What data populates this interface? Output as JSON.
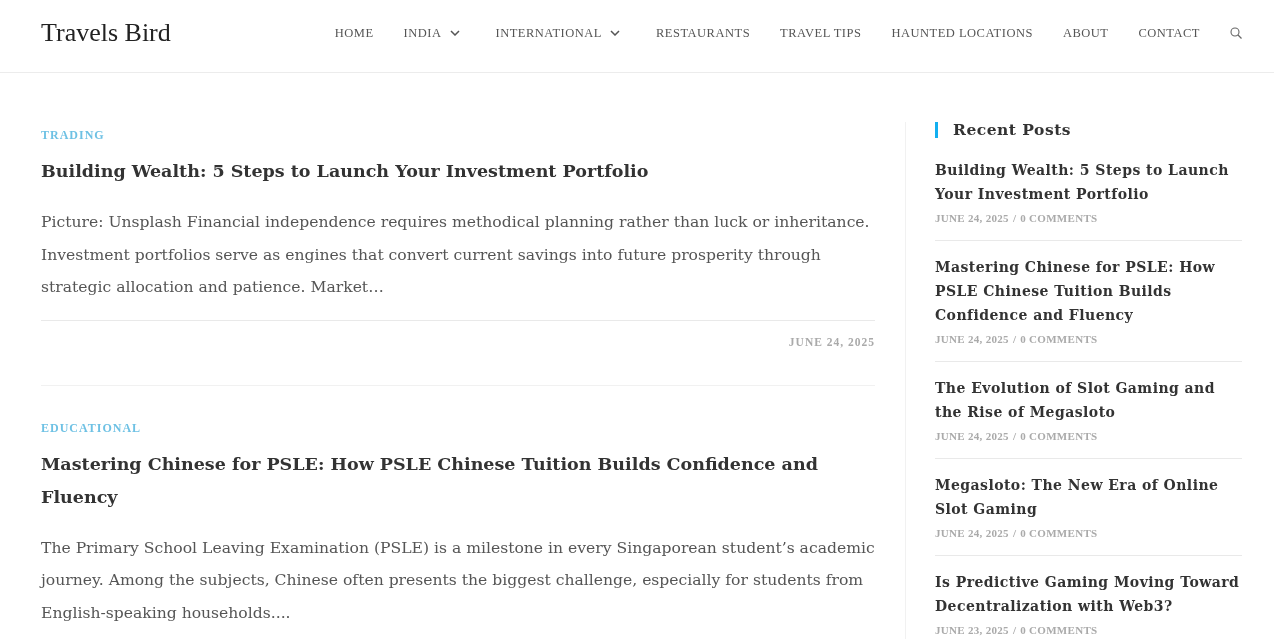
{
  "header": {
    "logo": "Travels Bird",
    "nav": [
      {
        "label": "HOME",
        "has_dropdown": false
      },
      {
        "label": "INDIA",
        "has_dropdown": true
      },
      {
        "label": "INTERNATIONAL",
        "has_dropdown": true
      },
      {
        "label": "RESTAURANTS",
        "has_dropdown": false
      },
      {
        "label": "TRAVEL TIPS",
        "has_dropdown": false
      },
      {
        "label": "HAUNTED LOCATIONS",
        "has_dropdown": false
      },
      {
        "label": "ABOUT",
        "has_dropdown": false
      },
      {
        "label": "CONTACT",
        "has_dropdown": false
      }
    ]
  },
  "posts": [
    {
      "category": "TRADING",
      "title": "Building Wealth: 5 Steps to Launch Your Investment Portfolio",
      "excerpt": "Picture: Unsplash Financial independence requires methodical planning rather than luck or inheritance. Investment portfolios serve as engines that convert current savings into future prosperity through strategic allocation and patience. Market…",
      "date": "JUNE 24, 2025"
    },
    {
      "category": "EDUCATIONAL",
      "title": "Mastering Chinese for PSLE: How PSLE Chinese Tuition Builds Confidence and Fluency",
      "excerpt": "The Primary School Leaving Examination (PSLE) is a milestone in every Singaporean student’s academic journey. Among the subjects, Chinese often presents the biggest challenge, especially for students from English-speaking households...."
    }
  ],
  "sidebar": {
    "title": "Recent Posts",
    "posts": [
      {
        "title": "Building Wealth: 5 Steps to Launch Your Investment Portfolio",
        "date": "JUNE 24, 2025",
        "separator": "/",
        "comments": "0 COMMENTS"
      },
      {
        "title": "Mastering Chinese for PSLE: How PSLE Chinese Tuition Builds Confidence and Fluency",
        "date": "JUNE 24, 2025",
        "separator": "/",
        "comments": "0 COMMENTS"
      },
      {
        "title": "The Evolution of Slot Gaming and the Rise of Megasloto",
        "date": "JUNE 24, 2025",
        "separator": "/",
        "comments": "0 COMMENTS"
      },
      {
        "title": "Megasloto: The New Era of Online Slot Gaming",
        "date": "JUNE 24, 2025",
        "separator": "/",
        "comments": "0 COMMENTS"
      },
      {
        "title": "Is Predictive Gaming Moving Toward Decentralization with Web3?",
        "date": "JUNE 23, 2025",
        "separator": "/",
        "comments": "0 COMMENTS"
      }
    ]
  }
}
